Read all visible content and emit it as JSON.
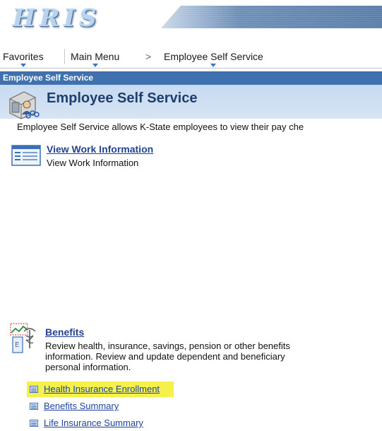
{
  "header": {
    "logo_text": "HRIS",
    "logo_icon": "hris-logo"
  },
  "nav": {
    "favorites": "Favorites",
    "main_menu": "Main Menu",
    "separator": ">",
    "current": "Employee Self Service"
  },
  "page": {
    "titlebar": "Employee Self Service",
    "heading": "Employee Self Service",
    "heading_icon": "employee-self-service-icon",
    "intro": "Employee Self Service allows K-State employees to view their pay che"
  },
  "sections": {
    "work": {
      "link": "View Work Information",
      "description": "View Work Information",
      "icon": "work-info-icon"
    },
    "benefits": {
      "link": "Benefits",
      "description_lines": [
        "Review health, insurance, savings, pension or other benefits",
        "information. Review and update dependent and beneficiary",
        "personal information."
      ],
      "icon": "benefits-icon",
      "sub_links": [
        {
          "label": "Health Insurance Enrollment",
          "highlighted": true
        },
        {
          "label": "Benefits Summary",
          "highlighted": false
        },
        {
          "label": "Life Insurance Summary",
          "highlighted": false
        }
      ]
    }
  },
  "colors": {
    "titlebar": "#3e71ae",
    "pagehead_bg": "#c7daf0",
    "link": "#22448f",
    "highlight": "#f6f04d",
    "caret": "#3a76c4"
  }
}
